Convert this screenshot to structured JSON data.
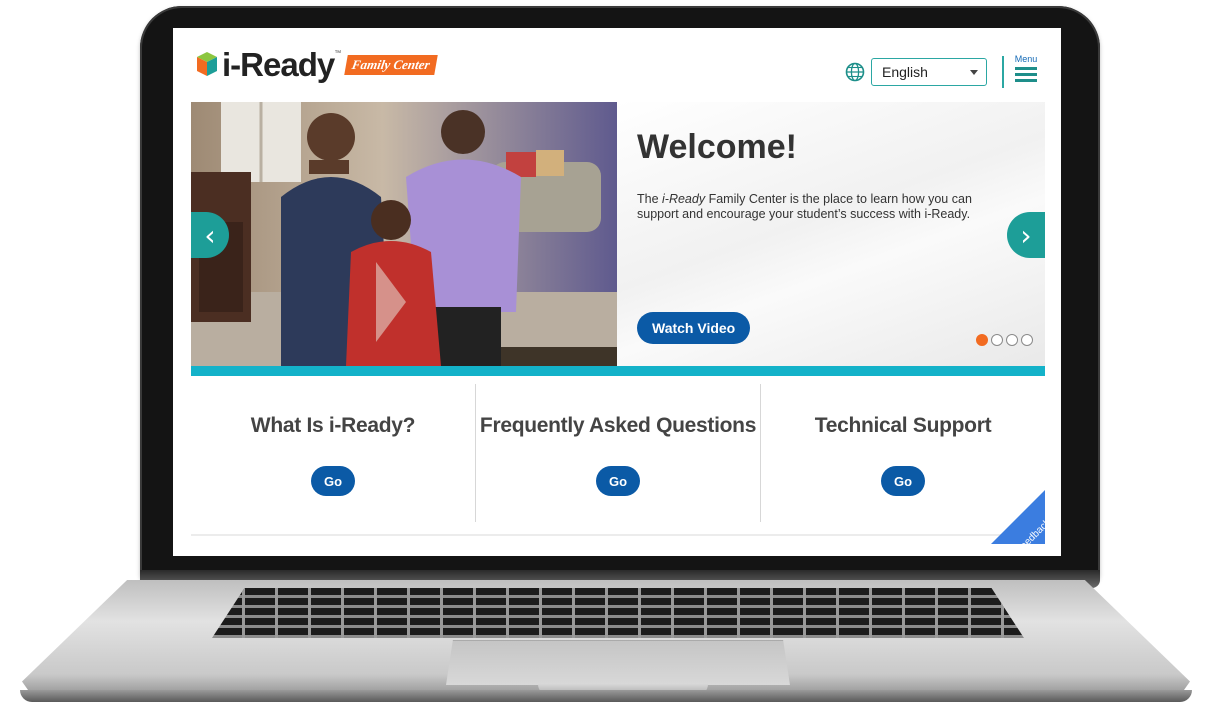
{
  "header": {
    "logo_text": "i-Ready",
    "logo_tm": "™",
    "logo_badge": "Family Center",
    "language": {
      "selected": "English"
    },
    "menu_label": "Menu"
  },
  "hero": {
    "title": "Welcome!",
    "desc_italic": "i-Ready",
    "desc_pre": "The ",
    "desc_post": " Family Center is the place to learn how you can support and encourage your student’s success with i-Ready.",
    "cta_label": "Watch Video",
    "slide_count": 4,
    "active_slide": 1,
    "prev_icon": "‹",
    "next_icon": "›"
  },
  "cards": [
    {
      "title": "What Is i-Ready?",
      "button": "Go"
    },
    {
      "title": "Frequently Asked Questions",
      "button": "Go"
    },
    {
      "title": "Technical Support",
      "button": "Go"
    }
  ],
  "feedback_label": "Feedback",
  "colors": {
    "brand_orange": "#f26b21",
    "brand_blue": "#0b5aa6",
    "teal": "#1d9e98",
    "band_cyan": "#14b2c9"
  }
}
